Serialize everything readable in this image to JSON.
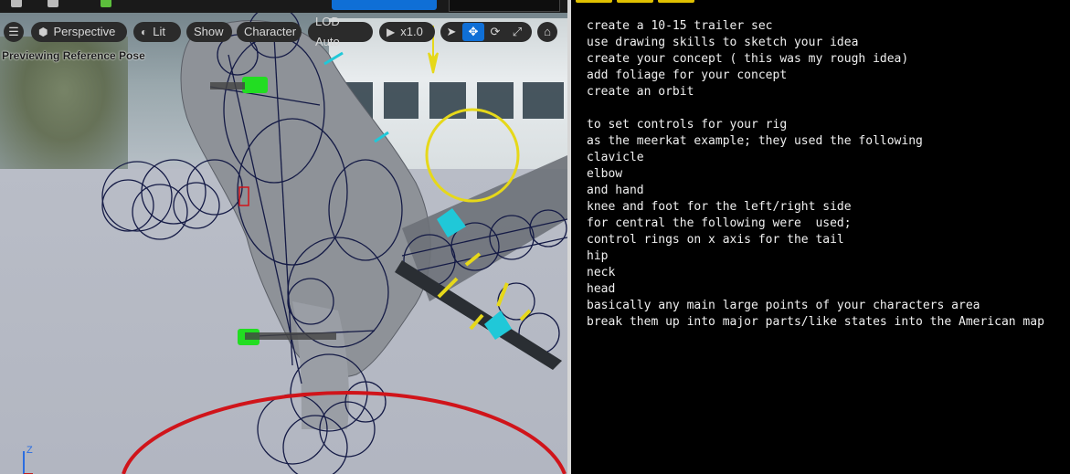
{
  "viewport": {
    "toolbar": {
      "menu_icon": "hamburger-menu-icon",
      "perspective_label": "Perspective",
      "lit_label": "Lit",
      "show_label": "Show",
      "character_label": "Character",
      "lod_label": "LOD Auto",
      "playback_speed": "x1.0",
      "transform_tools": [
        "select-arrow-icon",
        "move-icon",
        "rotate-icon",
        "scale-icon"
      ],
      "camera_icon": "camera-icon"
    },
    "status_label": "Previewing Reference Pose",
    "axis_label": "Z"
  },
  "notes": {
    "lines": [
      "create a 10-15 trailer sec",
      "use drawing skills to sketch your idea",
      "create your concept ( this was my rough idea)",
      "add foliage for your concept",
      "create an orbit",
      "",
      "to set controls for your rig",
      "as the meerkat example; they used the following",
      "clavicle",
      "elbow",
      "and hand",
      "knee and foot for the left/right side",
      "for central the following were  used;",
      "control rings on x axis for the tail",
      "hip",
      "neck",
      "head",
      "basically any main large points of your characters area",
      "break them up into major parts/like states into the American map"
    ]
  },
  "colors": {
    "accent_blue": "#0f6fd6",
    "gizmo_yellow": "#e6d81a",
    "gizmo_red": "#d0141a",
    "gizmo_cyan": "#20c8d8",
    "gizmo_green": "#22dd22",
    "rig_wire": "#141a45"
  }
}
